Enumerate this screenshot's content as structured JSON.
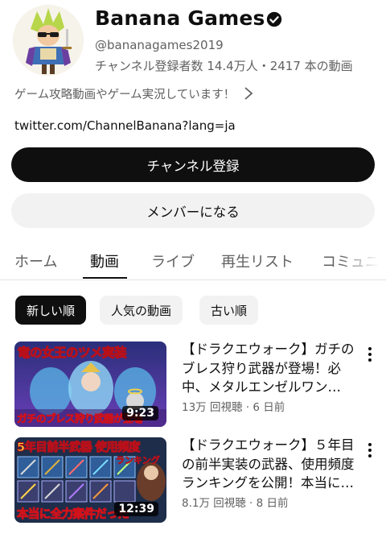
{
  "channel": {
    "name": "Banana Games",
    "handle": "@bananagames2019",
    "stats": "チャンネル登録者数 14.4万人・2417 本の動画",
    "description": "ゲーム攻略動画やゲーム実況しています！",
    "link": "twitter.com/ChannelBanana?lang=ja",
    "subscribe_label": "チャンネル登録",
    "member_label": "メンバーになる"
  },
  "tabs": [
    {
      "label": "ホーム"
    },
    {
      "label": "動画"
    },
    {
      "label": "ライブ"
    },
    {
      "label": "再生リスト"
    },
    {
      "label": "コミュニ"
    }
  ],
  "chips": [
    {
      "label": "新しい順"
    },
    {
      "label": "人気の動画"
    },
    {
      "label": "古い順"
    }
  ],
  "videos": [
    {
      "thumb_top_text": "竜の女王のツメ実装",
      "thumb_bottom_text": "ガチのブレス狩り武器が登場",
      "duration": "9:23",
      "title": "【ドラクエウォーク】ガチのブレス狩り武器が登場！必中、メタルエンゼルワン…",
      "meta": "13万 回視聴 · 6 日前"
    },
    {
      "thumb_top_text": "5年目前半武器 使用頻度",
      "thumb_badge_text": "ランキング",
      "thumb_bottom_text": "本当に全力案件だった",
      "duration": "12:39",
      "title": "【ドラクエウォーク】５年目の前半実装の武器、使用頻度ランキングを公開！本当に…",
      "meta": "8.1万 回視聴 · 8 日前"
    }
  ],
  "icons": {
    "verified": "verified-check-icon",
    "chevron": "chevron-right-icon",
    "more": "more-vert-icon"
  }
}
